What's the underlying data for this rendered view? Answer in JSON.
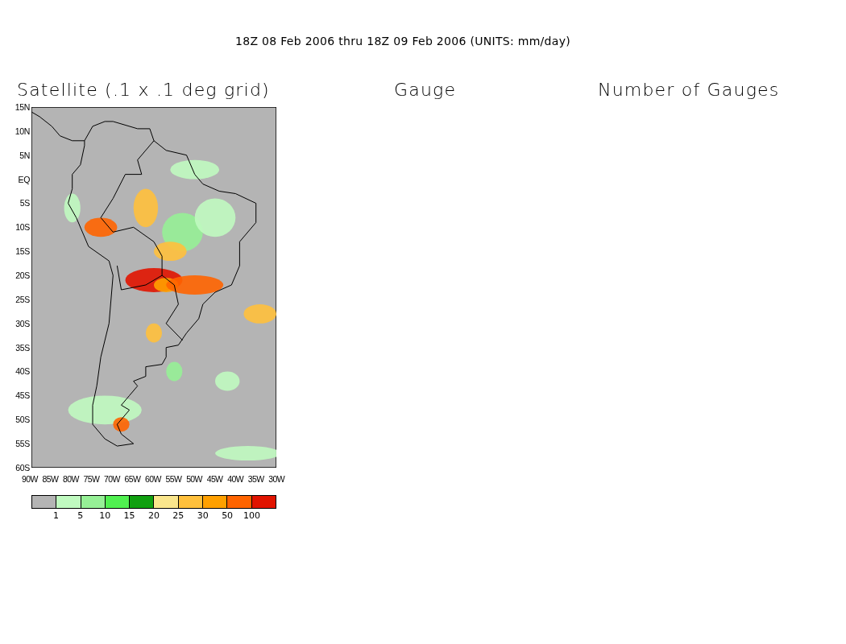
{
  "title": "18Z 08 Feb 2006 thru 18Z 09 Feb 2006 (UNITS: mm/day)",
  "panels": [
    {
      "title": "Satellite (.1 x .1 deg grid)",
      "kind": "map"
    },
    {
      "title": "Gauge",
      "kind": "empty"
    },
    {
      "title": "Number of Gauges",
      "kind": "empty"
    }
  ],
  "map": {
    "y_ticks": [
      "15N",
      "10N",
      "5N",
      "EQ",
      "5S",
      "10S",
      "15S",
      "20S",
      "25S",
      "30S",
      "35S",
      "40S",
      "45S",
      "50S",
      "55S",
      "60S"
    ],
    "x_ticks": [
      "90W",
      "85W",
      "80W",
      "75W",
      "70W",
      "65W",
      "60W",
      "55W",
      "50W",
      "45W",
      "40W",
      "35W",
      "30W"
    ]
  },
  "colorbar": {
    "boxes": [
      {
        "color": "#b4b4b4"
      },
      {
        "color": "#c0fac0"
      },
      {
        "color": "#96f096"
      },
      {
        "color": "#50f050"
      },
      {
        "color": "#10a010"
      },
      {
        "color": "#fae68c"
      },
      {
        "color": "#ffc03c"
      },
      {
        "color": "#ffa000"
      },
      {
        "color": "#ff6400"
      },
      {
        "color": "#e11400"
      }
    ],
    "labels": [
      "1",
      "5",
      "10",
      "15",
      "20",
      "25",
      "30",
      "50",
      "100"
    ]
  }
}
